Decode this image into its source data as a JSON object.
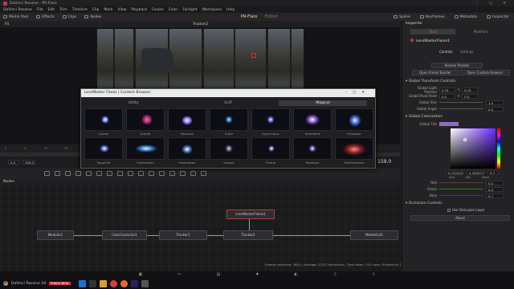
{
  "titlebar": {
    "title": "DaVinci Resolve - PR-Flare"
  },
  "menu": {
    "items": [
      "DaVinci Resolve",
      "File",
      "Edit",
      "Trim",
      "Timeline",
      "Clip",
      "Mark",
      "View",
      "Playback",
      "Fusion",
      "Color",
      "Fairlight",
      "Workspace",
      "Help"
    ]
  },
  "toolbar": {
    "items": [
      "Media Pool",
      "Effects",
      "Clips",
      "Nodes"
    ],
    "project": "PR-Flare",
    "edited": "Edited",
    "right_items": [
      "Spline",
      "Keyframes",
      "Metadata",
      "Inspector"
    ]
  },
  "viewer": {
    "zoom": "Fit",
    "name": "Tracker2"
  },
  "timeline": {
    "ticks": [
      "0",
      "10",
      "20",
      "30",
      "40",
      "50",
      "60",
      "70",
      "80",
      "90",
      "100",
      "110",
      "120",
      "130",
      "140",
      "150"
    ],
    "start": "0.0",
    "end": "359.0",
    "timecode": "0.722222",
    "current": "159.0"
  },
  "nodes": {
    "header": "Nodes",
    "items": [
      "MediaIn1",
      "ColorCorrector1",
      "Tracker1",
      "Tracker2",
      "LensMasterFlares1",
      "MediaOut1"
    ]
  },
  "status": "Frames rendered: 360.0, Average: 22.07 frames/sec, Time taken: 25.0 secs, Finished at Thu 6:23P - 44% - 13481 MB",
  "pagebar": {
    "items": [
      "media",
      "cut",
      "edit",
      "fusion",
      "color",
      "fairlight",
      "deliver"
    ]
  },
  "taskbar": {
    "app": "DaVinci Resolve 18",
    "badge": "PUBLIC BETA"
  },
  "inspector": {
    "title": "Inspector",
    "tabs": [
      "Tools",
      "Modifiers"
    ],
    "node": "LensMasterFlares1",
    "subtabs": [
      "Controls",
      "Settings"
    ],
    "browse": "Browse Presets",
    "open_builder": "Open Preset Builder",
    "open_custom": "Open Custom Browser",
    "section1": "Global Transform Controls",
    "p_light": "Global Light Position",
    "light_x": "0.75",
    "light_y": "0.75",
    "p_pivot": "Global Pivot Point",
    "pivot_x": "0.5",
    "pivot_y": "0.5",
    "p_size": "Global Size",
    "size": "1.0",
    "p_angle": "Global Angle",
    "angle": "0.0",
    "section2": "Global Colorization",
    "p_tint": "Global Tint",
    "hsv_h": "0.722222",
    "hsv_s": "0.430571",
    "hsv_v": "0.7",
    "hue": "Hue",
    "sat": "Sat",
    "val": "Value",
    "red": "Red",
    "red_v": "0.5",
    "green": "Green",
    "green_v": "0.4",
    "blue": "Blue",
    "blue_v": "0.7",
    "section3": "Occlusion Controls",
    "occl": "Use Occlusion Layer",
    "about": "About"
  },
  "browser": {
    "title": "LensMaster Flares | Content Browser",
    "categories": [
      "Utility",
      "Scifi",
      "Magical"
    ],
    "row1": [
      "Lumen",
      "Scarlet",
      "Patronus",
      "Aurre",
      "Hypnimous",
      "Streetlant",
      "Eriquetor"
    ],
    "row2": [
      "Sapphire",
      "Exploration",
      "Frostnation",
      "Impact",
      "Charm",
      "Mystique",
      "Exothermous"
    ]
  },
  "colors": {
    "accent": "#c23b3b",
    "tint": "#8a6fbf"
  }
}
